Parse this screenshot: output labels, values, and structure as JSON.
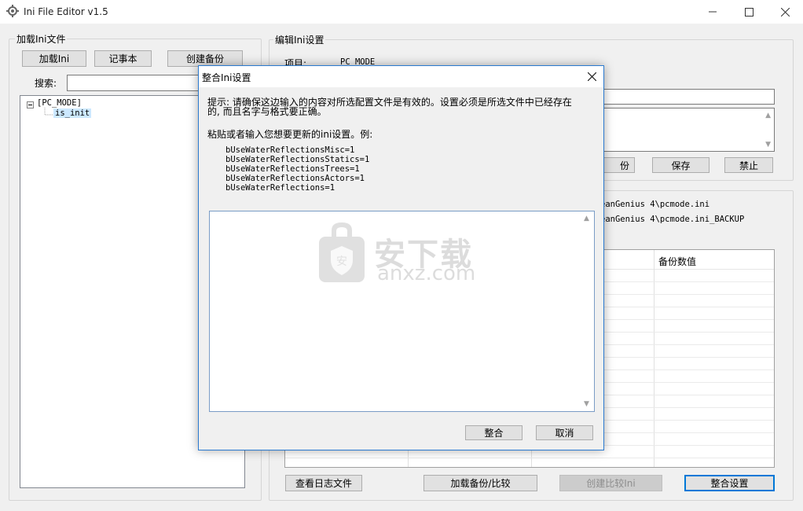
{
  "window": {
    "title": "Ini File Editor v1.5"
  },
  "left_panel": {
    "group_title": "加载Ini文件",
    "load_button": "加载Ini",
    "notepad_button": "记事本",
    "create_backup_button": "创建备份",
    "search_label": "搜索:",
    "search_value": "",
    "tree": {
      "root": "[PC_MODE]",
      "child": "is_init"
    }
  },
  "right_panel": {
    "group_title": "编辑Ini设置",
    "item_label": "项目:",
    "item_value": "PC_MODE",
    "backup_button_partial": "份",
    "save_button": "保存",
    "disable_button": "禁止",
    "path1_partial": "eanGenius 4\\pcmode.ini",
    "path2_partial": "eanGenius 4\\pcmode.ini_BACKUP",
    "table_header_backup_value": "备份数值",
    "view_log_button": "查看日志文件",
    "load_compare_button": "加载备份/比较",
    "create_compare_button": "创建比较Ini",
    "merge_settings_button": "整合设置"
  },
  "dialog": {
    "title": "整合Ini设置",
    "hint_line1": "提示: 请确保这边输入的内容对所选配置文件是有效的。设置必须是所选文件中已经存在",
    "hint_line2": "的, 而且名字与格式要正确。",
    "instruction": "粘贴或者输入您想要更新的ini设置。例:",
    "examples": [
      "bUseWaterReflectionsMisc=1",
      "bUseWaterReflectionsStatics=1",
      "bUseWaterReflectionsTrees=1",
      "bUseWaterReflectionsActors=1",
      "bUseWaterReflections=1"
    ],
    "textarea_value": "",
    "merge_button": "整合",
    "cancel_button": "取消"
  },
  "watermark": {
    "cn": "安下载",
    "en": "anxz.com"
  },
  "icons": [
    "app-gear-icon",
    "minimize-icon",
    "maximize-icon",
    "close-icon",
    "dialog-close-icon",
    "tree-collapse-icon",
    "watermark-shield-icon"
  ]
}
